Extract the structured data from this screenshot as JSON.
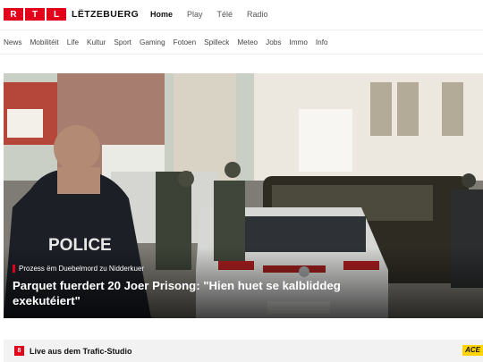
{
  "brand": {
    "letters": [
      "R",
      "T",
      "L"
    ],
    "name": "LËTZEBUERG"
  },
  "main_nav": [
    "Home",
    "Play",
    "Télé",
    "Radio"
  ],
  "sub_nav": [
    "News",
    "Mobilitéit",
    "Life",
    "Kultur",
    "Sport",
    "Gaming",
    "Fotoen",
    "Spilleck",
    "Meteo",
    "Jobs",
    "Immo",
    "Info"
  ],
  "hero": {
    "kicker": "Prozess ëm Duebelmord zu Nidderkuer",
    "headline": "Parquet fuerdert 20 Joer Prisong: \"Hien huet se kalbliddeg exekutéiert\"",
    "vest_text": "POLICE"
  },
  "live": {
    "badge": "8",
    "title": "Live aus dem Trafic-Studio",
    "partner": "ACE"
  },
  "colors": {
    "brand_red": "#e2001a",
    "accent_yellow": "#ffd400"
  }
}
